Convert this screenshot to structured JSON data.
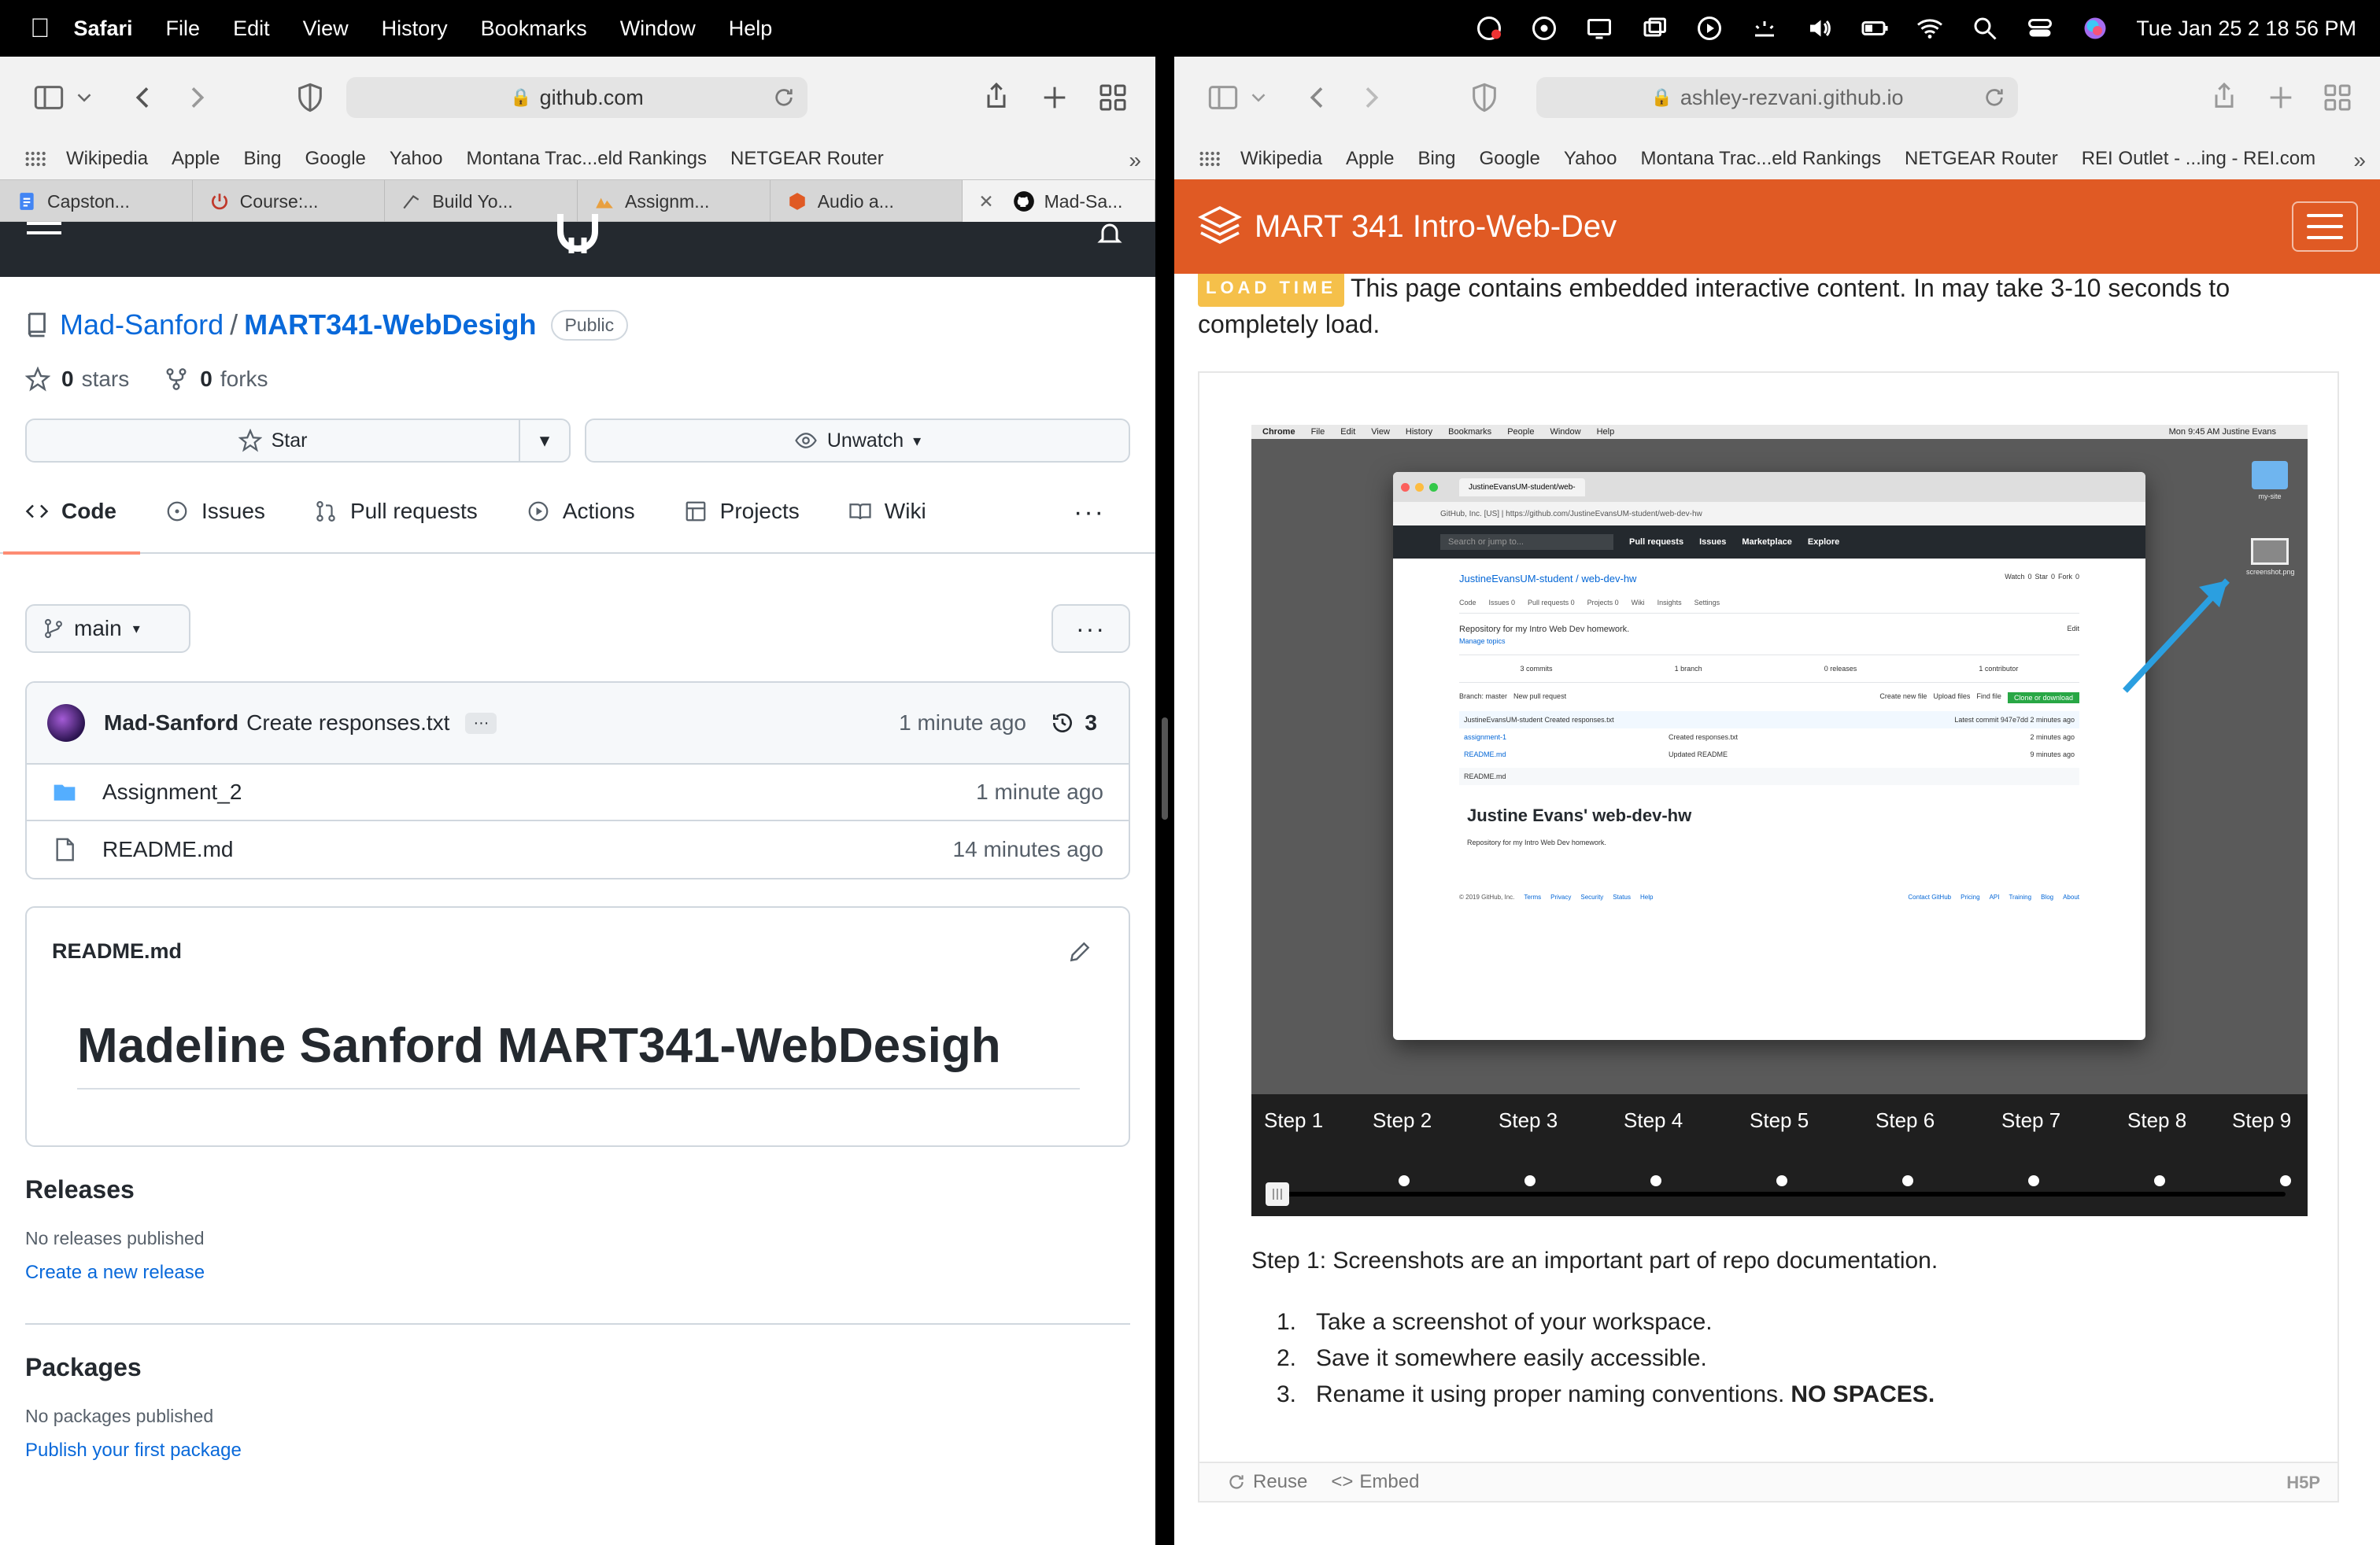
{
  "menubar": {
    "app": "Safari",
    "items": [
      "File",
      "Edit",
      "View",
      "History",
      "Bookmarks",
      "Window",
      "Help"
    ],
    "clock": "Tue Jan 25  2 18 56 PM"
  },
  "left": {
    "url": "github.com",
    "favorites": [
      "Wikipedia",
      "Apple",
      "Bing",
      "Google",
      "Yahoo",
      "Montana Trac...eld Rankings",
      "NETGEAR Router"
    ],
    "tabs": [
      "Capston...",
      "Course:...",
      "Build Yo...",
      "Assignm...",
      "Audio a...",
      "Mad-Sa..."
    ],
    "repo": {
      "owner": "Mad-Sanford",
      "name": "MART341-WebDesigh",
      "visibility": "Public",
      "stars_count": "0",
      "stars_label": "stars",
      "forks_count": "0",
      "forks_label": "forks",
      "star_button": "Star",
      "watch_button": "Unwatch"
    },
    "nav": [
      "Code",
      "Issues",
      "Pull requests",
      "Actions",
      "Projects",
      "Wiki"
    ],
    "branch": "main",
    "commit": {
      "author": "Mad-Sanford",
      "message": "Create responses.txt",
      "time": "1 minute ago",
      "count": "3"
    },
    "files": [
      {
        "name": "Assignment_2",
        "type": "folder",
        "time": "1 minute ago"
      },
      {
        "name": "README.md",
        "type": "file",
        "time": "14 minutes ago"
      }
    ],
    "readme": {
      "title": "README.md",
      "heading": "Madeline Sanford MART341-WebDesigh"
    },
    "releases": {
      "title": "Releases",
      "empty": "No releases published",
      "link": "Create a new release"
    },
    "packages": {
      "title": "Packages",
      "empty": "No packages published",
      "link": "Publish your first package"
    }
  },
  "right": {
    "url": "ashley-rezvani.github.io",
    "favorites": [
      "Wikipedia",
      "Apple",
      "Bing",
      "Google",
      "Yahoo",
      "Montana Trac...eld Rankings",
      "NETGEAR Router",
      "REI Outlet - ...ing - REI.com"
    ],
    "site_title": "MART 341 Intro-Web-Dev",
    "load_tag": "LOAD TIME",
    "load_text": "This page contains embedded interactive content. In may take 3-10 seconds to completely load.",
    "steps": [
      "Step 1",
      "Step 2",
      "Step 3",
      "Step 4",
      "Step 5",
      "Step 6",
      "Step 7",
      "Step 8",
      "Step 9"
    ],
    "current_step": 1,
    "caption": "Step 1: Screenshots are an important part of repo documentation.",
    "list": [
      {
        "num": "1.",
        "text": "Take a screenshot of your workspace.",
        "bold": ""
      },
      {
        "num": "2.",
        "text": "Save it somewhere easily accessible.",
        "bold": ""
      },
      {
        "num": "3.",
        "text": "Rename it using proper naming conventions.",
        "bold": "NO SPACES."
      }
    ],
    "footer": {
      "reuse": "Reuse",
      "embed": "Embed",
      "logo": "H5P"
    },
    "screenshot": {
      "menubar": [
        "Chrome",
        "File",
        "Edit",
        "View",
        "History",
        "Bookmarks",
        "People",
        "Window",
        "Help"
      ],
      "menubar_time": "Mon 9:45 AM  Justine Evans",
      "tab_label": "JustineEvansUM-student/web-",
      "url": "GitHub, Inc. [US] | https://github.com/JustineEvansUM-student/web-dev-hw",
      "search_placeholder": "Search or jump to...",
      "gh_nav": [
        "Pull requests",
        "Issues",
        "Marketplace",
        "Explore"
      ],
      "repo_path": "JustineEvansUM-student / web-dev-hw",
      "repo_buttons": [
        "Watch",
        "0",
        "Star",
        "0",
        "Fork",
        "0"
      ],
      "repo_tabs": [
        "Code",
        "Issues 0",
        "Pull requests 0",
        "Projects 0",
        "Wiki",
        "Insights",
        "Settings"
      ],
      "description": "Repository for my Intro Web Dev homework.",
      "edit": "Edit",
      "manage_topics": "Manage topics",
      "stats": [
        "3 commits",
        "1 branch",
        "0 releases",
        "1 contributor"
      ],
      "branch_btn": "Branch: master",
      "new_pr_btn": "New pull request",
      "file_btns": [
        "Create new file",
        "Upload files",
        "Find file"
      ],
      "clone_btn": "Clone or download",
      "latest_commit": "JustineEvansUM-student Created responses.txt",
      "latest_commit_meta": "Latest commit 947e7dd 2 minutes ago",
      "files": [
        {
          "name": "assignment-1",
          "msg": "Created responses.txt",
          "time": "2 minutes ago"
        },
        {
          "name": "README.md",
          "msg": "Updated README",
          "time": "9 minutes ago"
        }
      ],
      "readme_label": "README.md",
      "readme_heading": "Justine Evans' web-dev-hw",
      "readme_body": "Repository for my Intro Web Dev homework.",
      "footer_left": "© 2019 GitHub, Inc.",
      "footer_links_left": [
        "Terms",
        "Privacy",
        "Security",
        "Status",
        "Help"
      ],
      "footer_links_right": [
        "Contact GitHub",
        "Pricing",
        "API",
        "Training",
        "Blog",
        "About"
      ],
      "desktop_icons": [
        "my-site",
        "screenshot.png"
      ]
    }
  },
  "colors": {
    "site_orange": "#e05a24",
    "gh_link": "#0969da",
    "load_tag": "#f5c04a",
    "nav_underline": "#fd8c73"
  }
}
